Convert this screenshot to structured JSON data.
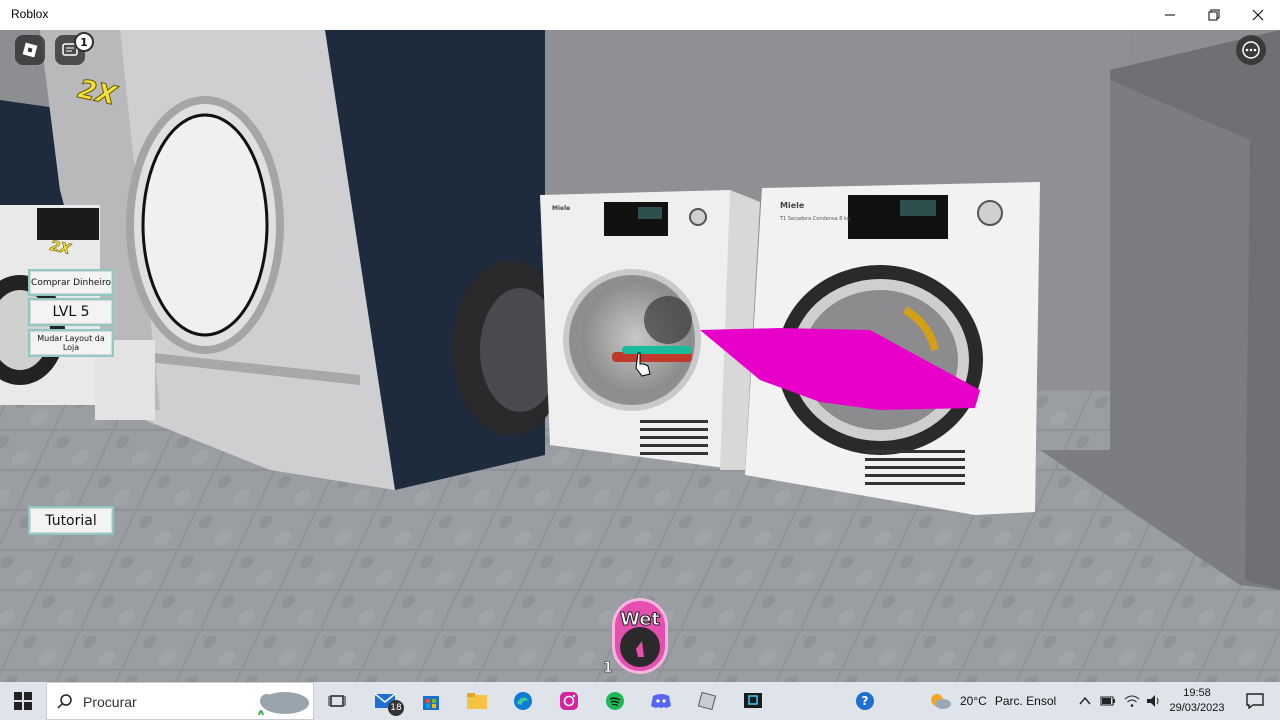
{
  "window": {
    "title": "Roblox",
    "minimize_icon": "minimize-icon",
    "maximize_icon": "restore-icon",
    "close_icon": "close-icon"
  },
  "hud": {
    "roblox_menu_icon": "roblox-logo-icon",
    "chat_icon": "chat-icon",
    "chat_unread": "1",
    "more_icon": "more-options-icon",
    "multiplier": "2X",
    "multiplier_small": "2X",
    "buy_money_label": "Comprar Dinheiro",
    "level_label": "LVL 5",
    "change_layout_label": "Mudar Layout da Loja",
    "tutorial_label": "Tutorial",
    "hotbar": {
      "slot_label": "Wet",
      "slot_number": "1"
    }
  },
  "scene": {
    "brand_left_dryer": "Miele",
    "brand_right_dryer": "Miele",
    "description_right": "T1 Secadora Condensa 8 kg",
    "carried_item_color": "#e600c8"
  },
  "taskbar": {
    "search_placeholder": "Procurar",
    "mail_badge": "18",
    "weather_temp": "20°C",
    "weather_text": "Parc. Ensol",
    "time": "19:58",
    "date": "29/03/2023",
    "icons": [
      "windows-start-icon",
      "search-icon",
      "task-view-icon",
      "mail-icon",
      "store-icon",
      "file-explorer-icon",
      "edge-icon",
      "instagram-icon",
      "spotify-icon",
      "discord-icon",
      "roblox-icon",
      "roblox-studio-icon",
      "help-icon",
      "weather-icon",
      "chevron-up-icon",
      "battery-icon",
      "wifi-icon",
      "volume-icon",
      "notification-icon"
    ]
  },
  "colors": {
    "hud_border": "#8fc9c3",
    "hotbar_pink": "#e54fb0",
    "multiplier_yellow": "#f5e23a"
  }
}
